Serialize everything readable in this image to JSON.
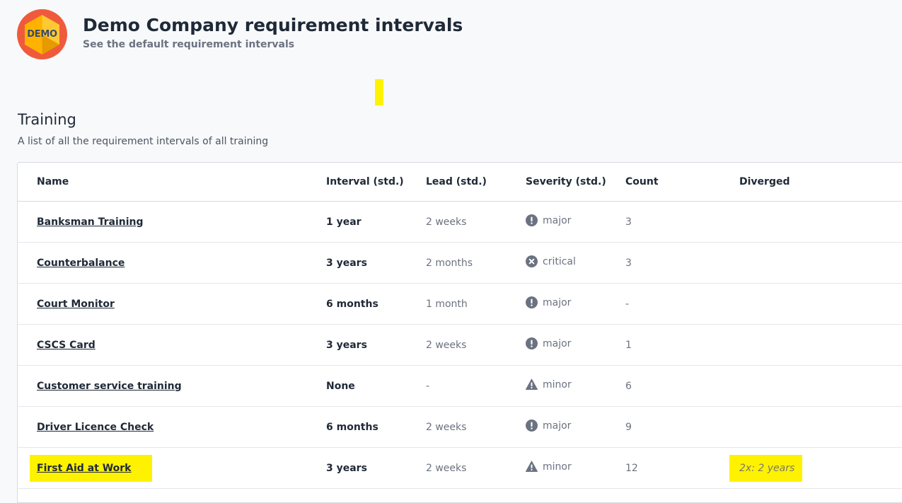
{
  "header": {
    "logo_text": "DEMO",
    "title": "Demo Company requirement intervals",
    "subtitle": "See the default requirement intervals"
  },
  "section": {
    "title": "Training",
    "description": "A list of all the requirement intervals of all training"
  },
  "table": {
    "columns": {
      "name": "Name",
      "interval": "Interval (std.)",
      "lead": "Lead (std.)",
      "severity": "Severity (std.)",
      "count": "Count",
      "diverged": "Diverged"
    },
    "rows": [
      {
        "name": "Banksman Training",
        "interval": "1 year",
        "lead": "2 weeks",
        "severity": "major",
        "severity_icon": "exclamation-circle-icon",
        "count": "3",
        "diverged": ""
      },
      {
        "name": "Counterbalance",
        "interval": "3 years",
        "lead": "2 months",
        "severity": "critical",
        "severity_icon": "x-circle-icon",
        "count": "3",
        "diverged": ""
      },
      {
        "name": "Court Monitor",
        "interval": "6 months",
        "lead": "1 month",
        "severity": "major",
        "severity_icon": "exclamation-circle-icon",
        "count": "-",
        "diverged": ""
      },
      {
        "name": "CSCS Card",
        "interval": "3 years",
        "lead": "2 weeks",
        "severity": "major",
        "severity_icon": "exclamation-circle-icon",
        "count": "1",
        "diverged": ""
      },
      {
        "name": "Customer service training",
        "interval": "None",
        "lead": "-",
        "severity": "minor",
        "severity_icon": "warning-triangle-icon",
        "count": "6",
        "diverged": ""
      },
      {
        "name": "Driver Licence Check",
        "interval": "6 months",
        "lead": "2 weeks",
        "severity": "major",
        "severity_icon": "exclamation-circle-icon",
        "count": "9",
        "diverged": ""
      },
      {
        "name": "First Aid at Work",
        "interval": "3 years",
        "lead": "2 weeks",
        "severity": "minor",
        "severity_icon": "warning-triangle-icon",
        "count": "12",
        "diverged": "2x: 2 years"
      }
    ]
  },
  "colors": {
    "highlight": "#fff200",
    "logo_red": "#f05a3c",
    "logo_orange": "#ffb300",
    "icon_gray": "#6b7280"
  }
}
